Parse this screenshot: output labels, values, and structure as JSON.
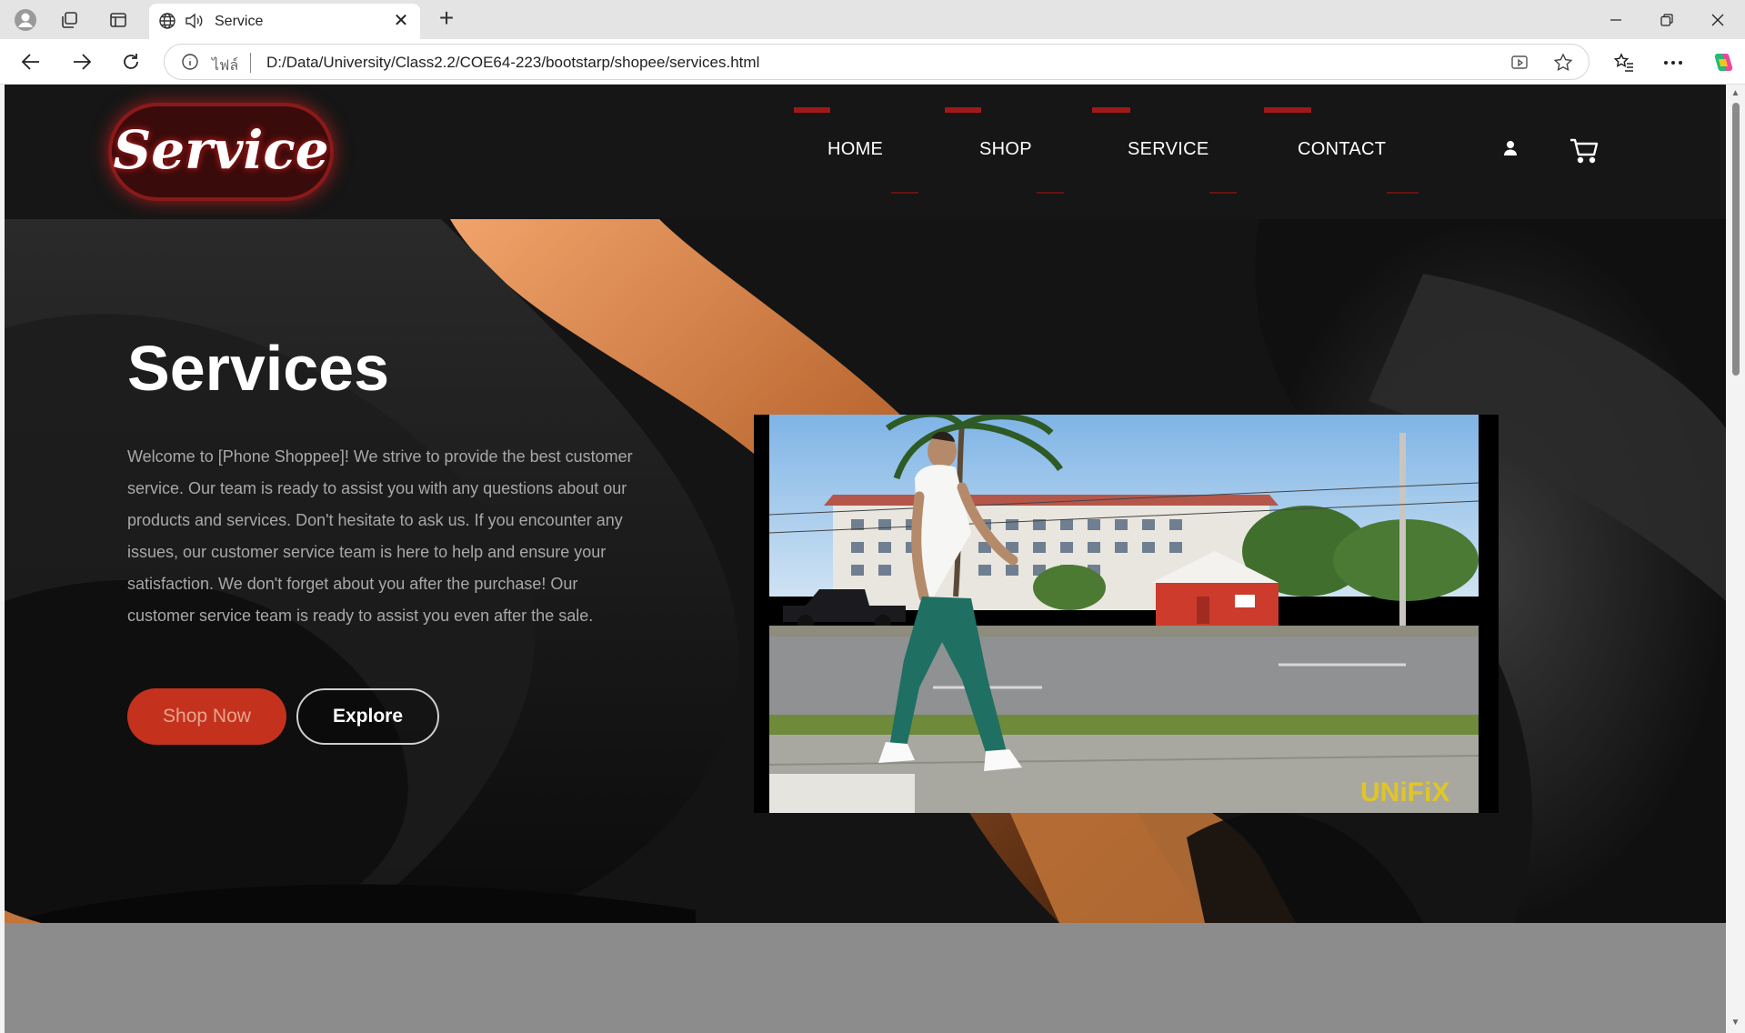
{
  "browser": {
    "tab_title": "Service",
    "address_prefix": "ไฟล์",
    "url": "D:/Data/University/Class2.2/COE64-223/bootstarp/shopee/services.html"
  },
  "site": {
    "logo_text": "Service",
    "nav": [
      {
        "label": "HOME"
      },
      {
        "label": "SHOP"
      },
      {
        "label": "SERVICE"
      },
      {
        "label": "CONTACT"
      }
    ]
  },
  "hero": {
    "title": "Services",
    "paragraph": "Welcome to [Phone Shoppee]! We strive to provide the best customer service. Our team is ready to assist you with any questions about our products and services. Don't hesitate to ask us. If you encounter any issues, our customer service team is here to help and ensure your satisfaction. We don't forget about you after the purchase! Our customer service team is ready to assist you even after the sale.",
    "shop_button": "Shop Now",
    "explore_button": "Explore",
    "video_watermark": "UNiFiX"
  },
  "colors": {
    "header_bg": "#161616",
    "accent_red": "#a01919",
    "shop_button": "#c4321d",
    "hero_orange": "#b8652e"
  }
}
